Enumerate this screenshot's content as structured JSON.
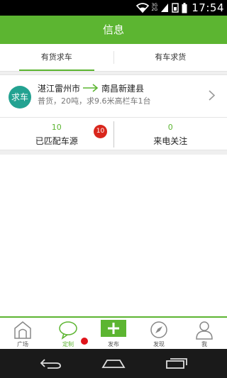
{
  "status_bar": {
    "time": "17:54",
    "network_type_top": "3G",
    "network_type_bottom": "2G",
    "icons": [
      "wifi-icon",
      "signal-icon",
      "sim-icon",
      "battery-icon"
    ]
  },
  "header": {
    "title": "信息"
  },
  "tabs": [
    {
      "label": "有货求车",
      "active": true
    },
    {
      "label": "有车求货",
      "active": false
    }
  ],
  "card": {
    "badge": "求车",
    "origin": "湛江雷州市",
    "destination": "南昌新建县",
    "description": "普货，20吨，求9.6米高栏车1台",
    "matched_count": "10",
    "matched_label": "已匹配车源",
    "matched_badge": "10",
    "calls_count": "0",
    "calls_label": "来电关注"
  },
  "bottom_nav": [
    {
      "label": "广场",
      "icon": "plaza-icon",
      "active": false
    },
    {
      "label": "定制",
      "icon": "chat-bubble-icon",
      "active": true
    },
    {
      "label": "发布",
      "icon": "plus-icon",
      "active": false
    },
    {
      "label": "发现",
      "icon": "compass-icon",
      "active": false
    },
    {
      "label": "我",
      "icon": "person-icon",
      "active": false
    }
  ],
  "colors": {
    "accent": "#5cb531",
    "badge_teal": "#23a291",
    "badge_red": "#d9261c"
  }
}
